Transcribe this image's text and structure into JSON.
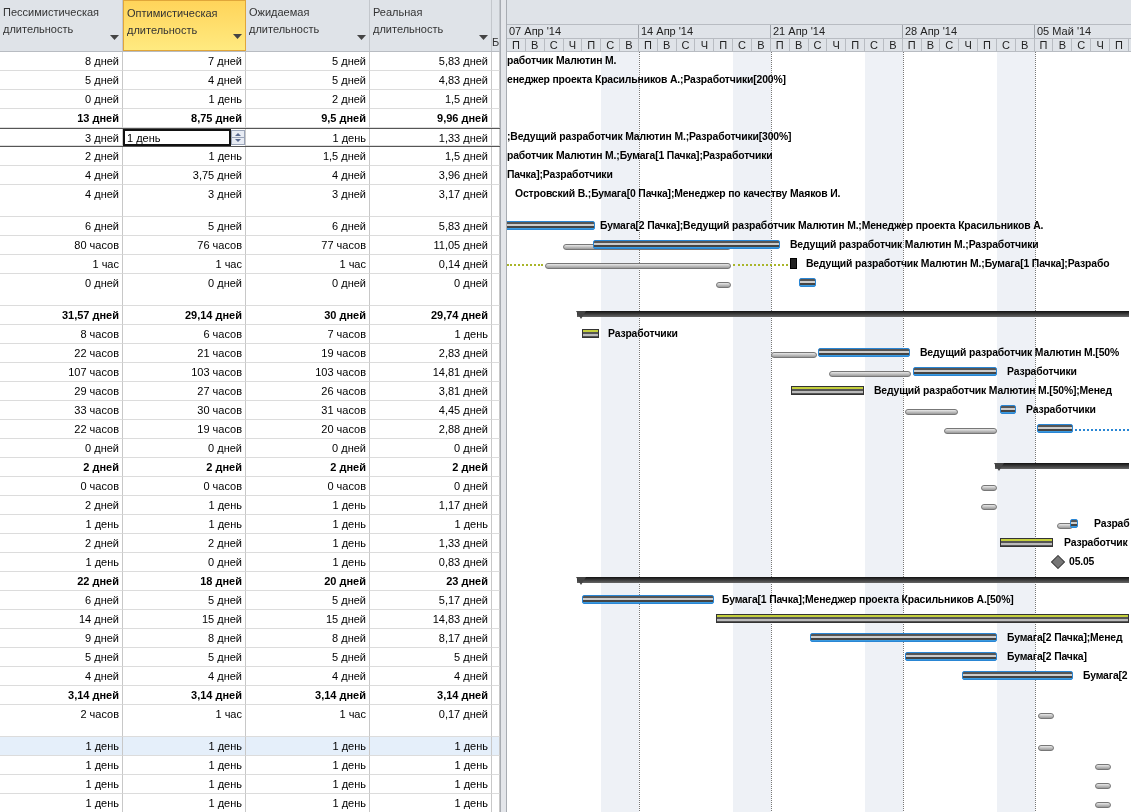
{
  "columns": [
    {
      "label": "Пессимистическая длительность",
      "selected": false
    },
    {
      "label": "Оптимистическая длительность",
      "selected": true
    },
    {
      "label": "Ожидаемая длительность",
      "selected": false
    },
    {
      "label": "Реальная длительность",
      "selected": false
    }
  ],
  "column_5": {
    "label": "Б"
  },
  "rows": [
    {
      "cells": [
        "8 дней",
        "7 дней",
        "5 дней",
        "5,83 дней"
      ],
      "kind": "task",
      "selected": false,
      "tall": false,
      "editing": false,
      "label": "работчик Малютин М."
    },
    {
      "cells": [
        "5 дней",
        "4 дней",
        "5 дней",
        "4,83 дней"
      ],
      "kind": "task",
      "selected": false,
      "tall": false,
      "editing": false,
      "label": "енеджер проекта Красильников А.;Разработчики[200%]"
    },
    {
      "cells": [
        "0 дней",
        "1 день",
        "2 дней",
        "1,5 дней"
      ],
      "kind": "task",
      "selected": false,
      "tall": false,
      "editing": false
    },
    {
      "cells": [
        "13 дней",
        "8,75 дней",
        "9,5 дней",
        "9,96 дней"
      ],
      "kind": "summary",
      "selected": false,
      "tall": false,
      "editing": false
    },
    {
      "cells": [
        "3 дней",
        "1 день",
        "1 день",
        "1,33 дней"
      ],
      "kind": "task",
      "selected": false,
      "tall": false,
      "editing": true,
      "label": ";Ведущий разработчик Малютин М.;Разработчики[300%]"
    },
    {
      "cells": [
        "2 дней",
        "1 день",
        "1,5 дней",
        "1,5 дней"
      ],
      "kind": "task",
      "selected": false,
      "tall": false,
      "editing": false,
      "label": "работчик Малютин М.;Бумага[1 Пачка];Разработчики"
    },
    {
      "cells": [
        "4 дней",
        "3,75 дней",
        "4 дней",
        "3,96 дней"
      ],
      "kind": "task",
      "selected": false,
      "tall": false,
      "editing": false,
      "label": "Пачка];Разработчики"
    },
    {
      "cells": [
        "4 дней",
        "3 дней",
        "3 дней",
        "3,17 дней"
      ],
      "kind": "task",
      "selected": false,
      "tall": true,
      "editing": false,
      "label": "Островский В.;Бумага[0 Пачка];Менеджер по качеству Маяков И."
    },
    {
      "cells": [
        "6 дней",
        "5 дней",
        "6 дней",
        "5,83 дней"
      ],
      "kind": "task",
      "selected": false,
      "tall": false,
      "editing": false,
      "label": "Бумага[2 Пачка];Ведущий разработчик Малютин М.;Менеджер проекта Красильников А."
    },
    {
      "cells": [
        "80 часов",
        "76 часов",
        "77 часов",
        "11,05 дней"
      ],
      "kind": "task",
      "selected": false,
      "tall": false,
      "editing": false,
      "label": "Ведущий разработчик Малютин М.;Разработчики"
    },
    {
      "cells": [
        "1 час",
        "1 час",
        "1 час",
        "0,14 дней"
      ],
      "kind": "task",
      "selected": false,
      "tall": false,
      "editing": false,
      "label": "Ведущий разработчик Малютин М.;Бумага[1 Пачка];Разрабо"
    },
    {
      "cells": [
        "0 дней",
        "0 дней",
        "0 дней",
        "0 дней"
      ],
      "kind": "task",
      "selected": false,
      "tall": true,
      "editing": false
    },
    {
      "cells": [
        "31,57 дней",
        "29,14 дней",
        "30 дней",
        "29,74 дней"
      ],
      "kind": "summary",
      "selected": false,
      "tall": false,
      "editing": false
    },
    {
      "cells": [
        "8 часов",
        "6 часов",
        "7 часов",
        "1 день"
      ],
      "kind": "task",
      "selected": false,
      "tall": false,
      "editing": false,
      "label": "Разработчики"
    },
    {
      "cells": [
        "22 часов",
        "21 часов",
        "19 часов",
        "2,83 дней"
      ],
      "kind": "task",
      "selected": false,
      "tall": false,
      "editing": false,
      "label": "Ведущий разработчик Малютин М.[50%"
    },
    {
      "cells": [
        "107 часов",
        "103 часов",
        "103 часов",
        "14,81 дней"
      ],
      "kind": "task",
      "selected": false,
      "tall": false,
      "editing": false,
      "label": "Разработчики"
    },
    {
      "cells": [
        "29 часов",
        "27 часов",
        "26 часов",
        "3,81 дней"
      ],
      "kind": "task",
      "selected": false,
      "tall": false,
      "editing": false,
      "label": "Ведущий разработчик Малютин М.[50%];Менед"
    },
    {
      "cells": [
        "33 часов",
        "30 часов",
        "31 часов",
        "4,45 дней"
      ],
      "kind": "task",
      "selected": false,
      "tall": false,
      "editing": false,
      "label": "Разработчики"
    },
    {
      "cells": [
        "22 часов",
        "19 часов",
        "20 часов",
        "2,88 дней"
      ],
      "kind": "task",
      "selected": false,
      "tall": false,
      "editing": false
    },
    {
      "cells": [
        "0 дней",
        "0 дней",
        "0 дней",
        "0 дней"
      ],
      "kind": "task",
      "selected": false,
      "tall": false,
      "editing": false
    },
    {
      "cells": [
        "2 дней",
        "2 дней",
        "2 дней",
        "2 дней"
      ],
      "kind": "summary",
      "selected": false,
      "tall": false,
      "editing": false
    },
    {
      "cells": [
        "0 часов",
        "0 часов",
        "0 часов",
        "0 дней"
      ],
      "kind": "task",
      "selected": false,
      "tall": false,
      "editing": false
    },
    {
      "cells": [
        "2 дней",
        "1 день",
        "1 день",
        "1,17 дней"
      ],
      "kind": "task",
      "selected": false,
      "tall": false,
      "editing": false
    },
    {
      "cells": [
        "1 день",
        "1 день",
        "1 день",
        "1 день"
      ],
      "kind": "task",
      "selected": false,
      "tall": false,
      "editing": false,
      "label": "Разраб"
    },
    {
      "cells": [
        "2 дней",
        "2 дней",
        "1 день",
        "1,33 дней"
      ],
      "kind": "task",
      "selected": false,
      "tall": false,
      "editing": false,
      "label": "Разработчик"
    },
    {
      "cells": [
        "1 день",
        "0 дней",
        "1 день",
        "0,83 дней"
      ],
      "kind": "task",
      "selected": false,
      "tall": false,
      "editing": false,
      "label": "05.05"
    },
    {
      "cells": [
        "22 дней",
        "18 дней",
        "20 дней",
        "23 дней"
      ],
      "kind": "summary",
      "selected": false,
      "tall": false,
      "editing": false
    },
    {
      "cells": [
        "6 дней",
        "5 дней",
        "5 дней",
        "5,17 дней"
      ],
      "kind": "task",
      "selected": false,
      "tall": false,
      "editing": false,
      "label": "Бумага[1 Пачка];Менеджер проекта Красильников А.[50%]"
    },
    {
      "cells": [
        "14 дней",
        "15 дней",
        "15 дней",
        "14,83 дней"
      ],
      "kind": "task",
      "selected": false,
      "tall": false,
      "editing": false
    },
    {
      "cells": [
        "9 дней",
        "8 дней",
        "8 дней",
        "8,17 дней"
      ],
      "kind": "task",
      "selected": false,
      "tall": false,
      "editing": false,
      "label": "Бумага[2 Пачка];Менед"
    },
    {
      "cells": [
        "5 дней",
        "5 дней",
        "5 дней",
        "5 дней"
      ],
      "kind": "task",
      "selected": false,
      "tall": false,
      "editing": false,
      "label": "Бумага[2 Пачка]"
    },
    {
      "cells": [
        "4 дней",
        "4 дней",
        "4 дней",
        "4 дней"
      ],
      "kind": "task",
      "selected": false,
      "tall": false,
      "editing": false,
      "label": "Бумага[2"
    },
    {
      "cells": [
        "3,14 дней",
        "3,14 дней",
        "3,14 дней",
        "3,14 дней"
      ],
      "kind": "summary",
      "selected": false,
      "tall": false,
      "editing": false
    },
    {
      "cells": [
        "2 часов",
        "1 час",
        "1 час",
        "0,17 дней"
      ],
      "kind": "task",
      "selected": false,
      "tall": true,
      "editing": false
    },
    {
      "cells": [
        "1 день",
        "1 день",
        "1 день",
        "1 день"
      ],
      "kind": "task",
      "selected": true,
      "tall": false,
      "editing": false
    },
    {
      "cells": [
        "1 день",
        "1 день",
        "1 день",
        "1 день"
      ],
      "kind": "task",
      "selected": false,
      "tall": false,
      "editing": false
    },
    {
      "cells": [
        "1 день",
        "1 день",
        "1 день",
        "1 день"
      ],
      "kind": "task",
      "selected": false,
      "tall": false,
      "editing": false
    },
    {
      "cells": [
        "1 день",
        "1 день",
        "1 день",
        "1 день"
      ],
      "kind": "task",
      "selected": false,
      "tall": false,
      "editing": false
    }
  ],
  "timescale": {
    "weeks": [
      {
        "label": "07 Апр '14",
        "days": [
          "П",
          "В",
          "С",
          "Ч",
          "П",
          "С",
          "В"
        ]
      },
      {
        "label": "14 Апр '14",
        "days": [
          "П",
          "В",
          "С",
          "Ч",
          "П",
          "С",
          "В"
        ]
      },
      {
        "label": "21 Апр '14",
        "days": [
          "П",
          "В",
          "С",
          "Ч",
          "П",
          "С",
          "В"
        ]
      },
      {
        "label": "28 Апр '14",
        "days": [
          "П",
          "В",
          "С",
          "Ч",
          "П",
          "С",
          "В"
        ]
      },
      {
        "label": "05 Май '14",
        "days": [
          "П",
          "В",
          "С",
          "Ч",
          "П"
        ]
      }
    ]
  }
}
